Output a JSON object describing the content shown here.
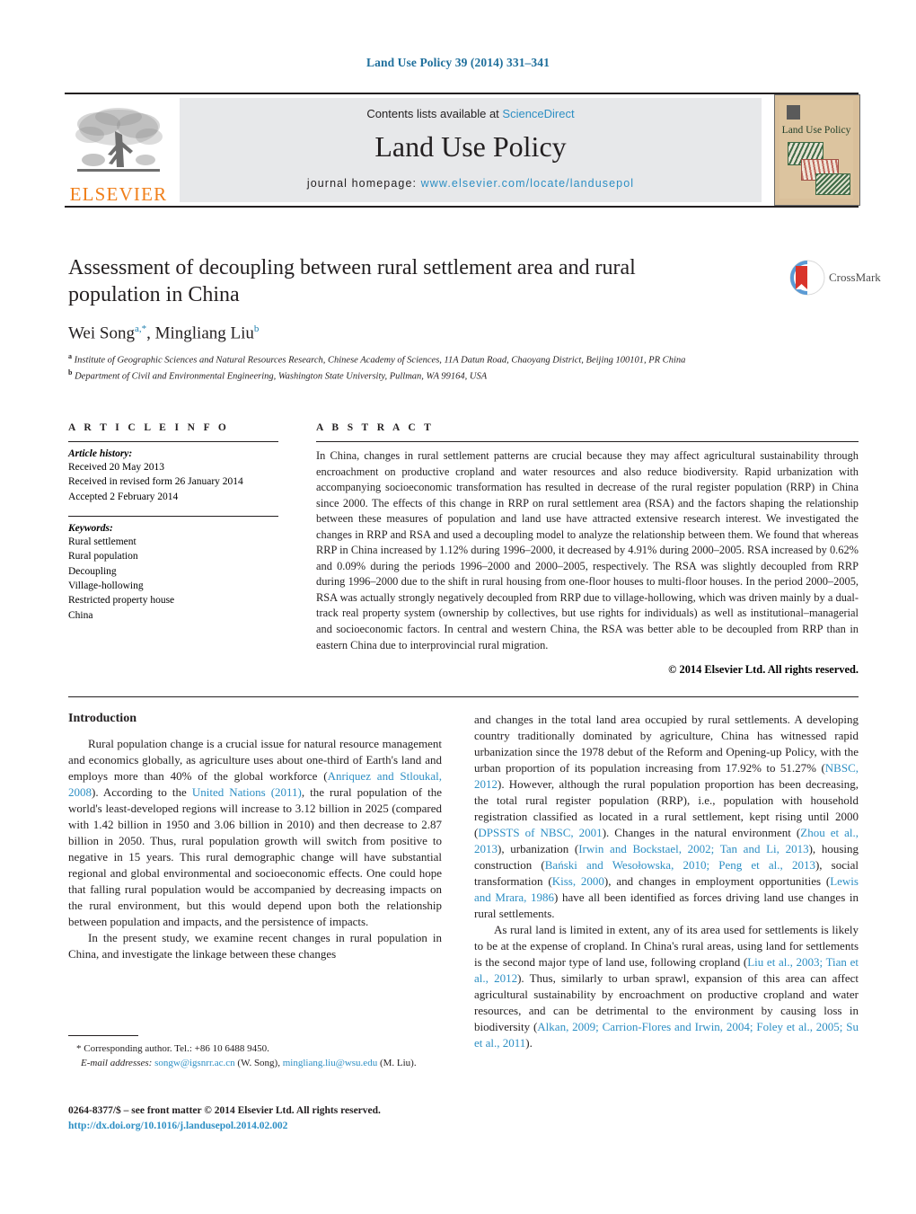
{
  "running_head": "Land Use Policy 39 (2014) 331–341",
  "masthead": {
    "contents_prefix": "Contents lists available at ",
    "sciencedirect": "ScienceDirect",
    "journal_title": "Land Use Policy",
    "homepage_label": "journal homepage:",
    "homepage_url": "www.elsevier.com/locate/landusepol",
    "publisher_logo_text": "ELSEVIER",
    "cover_title": "Land Use Policy"
  },
  "article": {
    "title": "Assessment of decoupling between rural settlement area and rural population in China",
    "authors": "Wei Song, Mingliang Liu",
    "author_1": "Wei Song",
    "author_1_sup": "a,*",
    "author_2": "Mingliang Liu",
    "author_2_sup": "b",
    "affiliation_a": "Institute of Geographic Sciences and Natural Resources Research, Chinese Academy of Sciences, 11A Datun Road, Chaoyang District, Beijing 100101, PR China",
    "affiliation_a_marker": "a",
    "affiliation_b": "Department of Civil and Environmental Engineering, Washington State University, Pullman, WA 99164, USA",
    "affiliation_b_marker": "b",
    "crossmark_label": "CrossMark"
  },
  "article_info": {
    "heading": "A R T I C L E   I N F O",
    "history_label": "Article history:",
    "history": [
      "Received 20 May 2013",
      "Received in revised form 26 January 2014",
      "Accepted 2 February 2014"
    ],
    "keywords_label": "Keywords:",
    "keywords": [
      "Rural settlement",
      "Rural population",
      "Decoupling",
      "Village-hollowing",
      "Restricted property house",
      "China"
    ]
  },
  "abstract": {
    "heading": "A B S T R A C T",
    "text": "In China, changes in rural settlement patterns are crucial because they may affect agricultural sustainability through encroachment on productive cropland and water resources and also reduce biodiversity. Rapid urbanization with accompanying socioeconomic transformation has resulted in decrease of the rural register population (RRP) in China since 2000. The effects of this change in RRP on rural settlement area (RSA) and the factors shaping the relationship between these measures of population and land use have attracted extensive research interest. We investigated the changes in RRP and RSA and used a decoupling model to analyze the relationship between them. We found that whereas RRP in China increased by 1.12% during 1996–2000, it decreased by 4.91% during 2000–2005. RSA increased by 0.62% and 0.09% during the periods 1996–2000 and 2000–2005, respectively. The RSA was slightly decoupled from RRP during 1996–2000 due to the shift in rural housing from one-floor houses to multi-floor houses. In the period 2000–2005, RSA was actually strongly negatively decoupled from RRP due to village-hollowing, which was driven mainly by a dual-track real property system (ownership by collectives, but use rights for individuals) as well as institutional–managerial and socioeconomic factors. In central and western China, the RSA was better able to be decoupled from RRP than in eastern China due to interprovincial rural migration.",
    "copyright": "© 2014 Elsevier Ltd. All rights reserved."
  },
  "body": {
    "section_heading": "Introduction",
    "left_paragraph_1_a": "Rural population change is a crucial issue for natural resource management and economics globally, as agriculture uses about one-third of Earth's land and employs more than 40% of the global workforce (",
    "left_cite_1": "Anriquez and Stloukal, 2008",
    "left_paragraph_1_b": "). According to the ",
    "left_cite_2": "United Nations (2011)",
    "left_paragraph_1_c": ", the rural population of the world's least-developed regions will increase to 3.12 billion in 2025 (compared with 1.42 billion in 1950 and 3.06 billion in 2010) and then decrease to 2.87 billion in 2050. Thus, rural population growth will switch from positive to negative in 15 years. This rural demographic change will have substantial regional and global environmental and socioeconomic effects. One could hope that falling rural population would be accompanied by decreasing impacts on the rural environment, but this would depend upon both the relationship between population and impacts, and the persistence of impacts.",
    "left_paragraph_2": "In the present study, we examine recent changes in rural population in China, and investigate the linkage between these changes",
    "right_paragraph_1_a": "and changes in the total land area occupied by rural settlements. A developing country traditionally dominated by agriculture, China has witnessed rapid urbanization since the 1978 debut of the Reform and Opening-up Policy, with the urban proportion of its population increasing from 17.92% to 51.27% (",
    "right_cite_1": "NBSC, 2012",
    "right_paragraph_1_b": "). However, although the rural population proportion has been decreasing, the total rural register population (RRP), i.e., population with household registration classified as located in a rural settlement, kept rising until 2000 (",
    "right_cite_2": "DPSSTS of NBSC, 2001",
    "right_paragraph_1_c": "). Changes in the natural environment (",
    "right_cite_3": "Zhou et al., 2013",
    "right_paragraph_1_d": "), urbanization (",
    "right_cite_4": "Irwin and Bockstael, 2002; Tan and Li, 2013",
    "right_paragraph_1_e": "), housing construction (",
    "right_cite_5": "Bański and Wesołowska, 2010; Peng et al., 2013",
    "right_paragraph_1_f": "), social transformation (",
    "right_cite_6": "Kiss, 2000",
    "right_paragraph_1_g": "), and changes in employment opportunities (",
    "right_cite_7": "Lewis and Mrara, 1986",
    "right_paragraph_1_h": ") have all been identified as forces driving land use changes in rural settlements.",
    "right_paragraph_2_a": "As rural land is limited in extent, any of its area used for settlements is likely to be at the expense of cropland. In China's rural areas, using land for settlements is the second major type of land use, following cropland (",
    "right_cite_8": "Liu et al., 2003; Tian et al., 2012",
    "right_paragraph_2_b": "). Thus, similarly to urban sprawl, expansion of this area can affect agricultural sustainability by encroachment on productive cropland and water resources, and can be detrimental to the environment by causing loss in biodiversity (",
    "right_cite_9": "Alkan, 2009; Carrion-Flores and Irwin, 2004; Foley et al., 2005; Su et al., 2011",
    "right_paragraph_2_c": ")."
  },
  "footnote": {
    "corresponding_marker": "*",
    "corresponding_text": "Corresponding author. Tel.: +86 10 6488 9450.",
    "email_label": "E-mail addresses:",
    "email_1": "songw@igsnrr.ac.cn",
    "email_1_owner": "(W. Song),",
    "email_2": "mingliang.liu@wsu.edu",
    "email_2_owner": "(M. Liu)."
  },
  "imprint": {
    "line1": "0264-8377/$ – see front matter © 2014 Elsevier Ltd. All rights reserved.",
    "doi": "http://dx.doi.org/10.1016/j.landusepol.2014.02.002"
  },
  "colors": {
    "link_blue": "#2d8fc4",
    "header_blue": "#1f6f9c",
    "elsevier_orange": "#f07f1a",
    "banner_gray": "#e7e8ea"
  }
}
